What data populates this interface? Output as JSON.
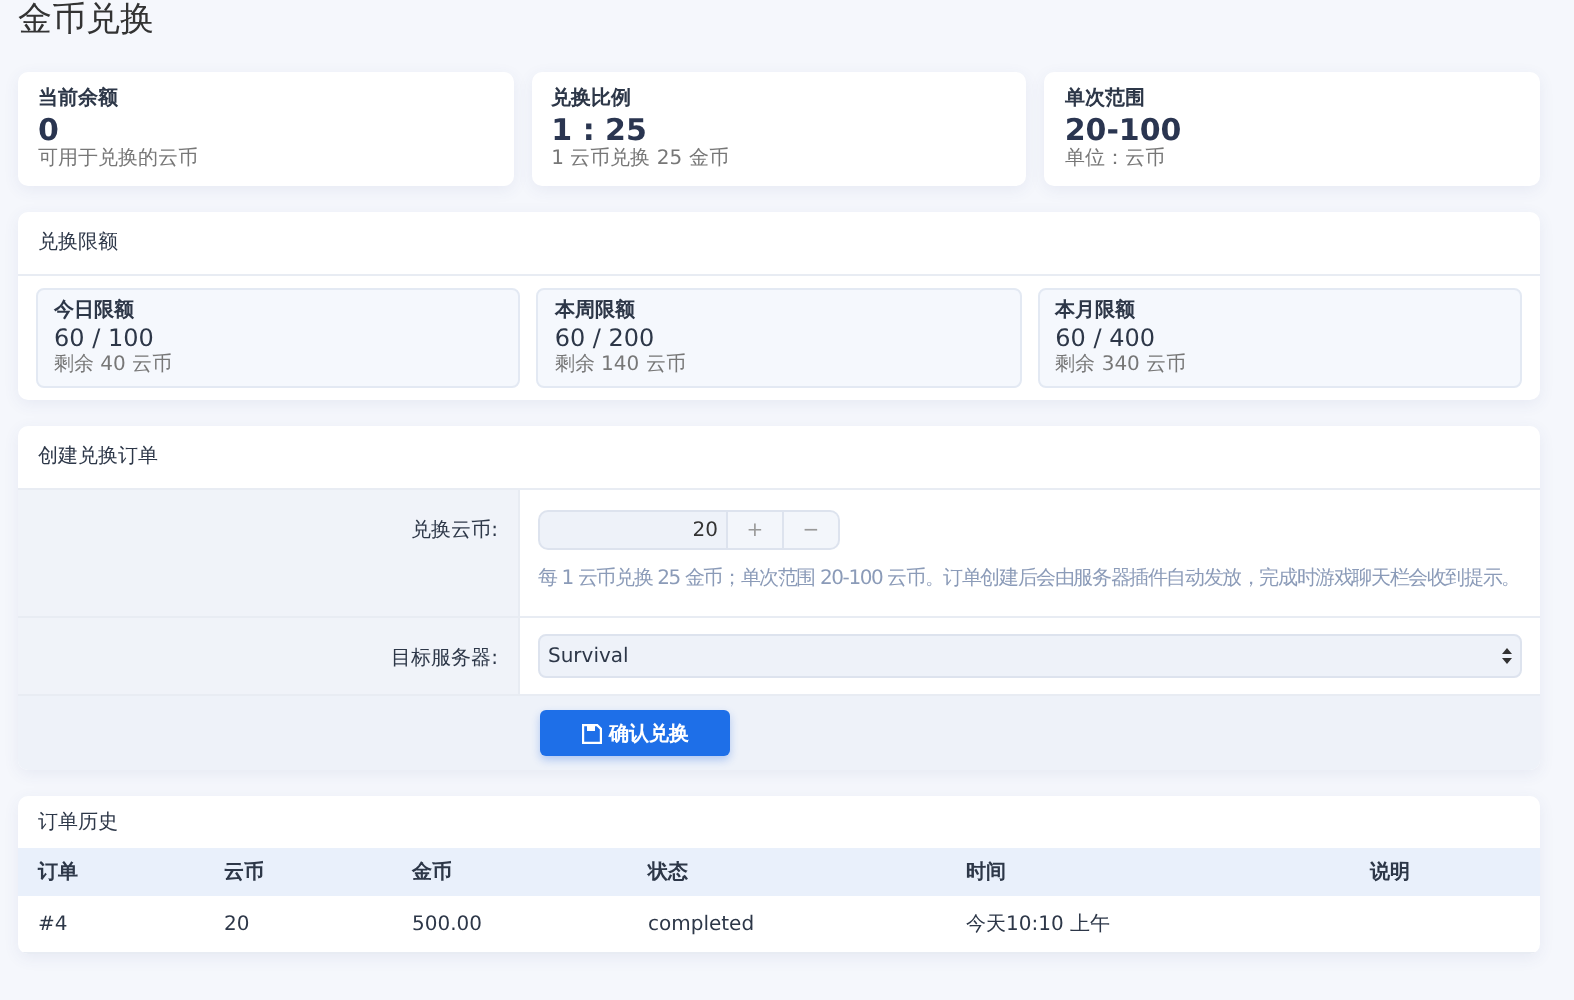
{
  "page_title": "金币兑换",
  "stats": [
    {
      "label": "当前余额",
      "value": "0",
      "note": "可用于兑换的云币"
    },
    {
      "label": "兑换比例",
      "value": "1 : 25",
      "note": "1 云币兑换 25 金币"
    },
    {
      "label": "单次范围",
      "value": "20-100",
      "note": "单位：云币"
    }
  ],
  "limits": {
    "title": "兑换限额",
    "items": [
      {
        "label": "今日限额",
        "value": "60 / 100",
        "note": "剩余 40 云币"
      },
      {
        "label": "本周限额",
        "value": "60 / 200",
        "note": "剩余 140 云币"
      },
      {
        "label": "本月限额",
        "value": "60 / 400",
        "note": "剩余 340 云币"
      }
    ]
  },
  "order_form": {
    "title": "创建兑换订单",
    "amount_label": "兑换云币:",
    "amount_value": "20",
    "plus": "+",
    "minus": "−",
    "hint": "每 1 云币兑换 25 金币；单次范围 20-100 云币。订单创建后会由服务器插件自动发放，完成时游戏聊天栏会收到提示。",
    "server_label": "目标服务器:",
    "server_value": "Survival",
    "submit": "确认兑换"
  },
  "history": {
    "title": "订单历史",
    "columns": [
      "订单",
      "云币",
      "金币",
      "状态",
      "时间",
      "说明"
    ],
    "rows": [
      [
        "#4",
        "20",
        "500.00",
        "completed",
        "今天10:10 上午",
        ""
      ]
    ]
  }
}
